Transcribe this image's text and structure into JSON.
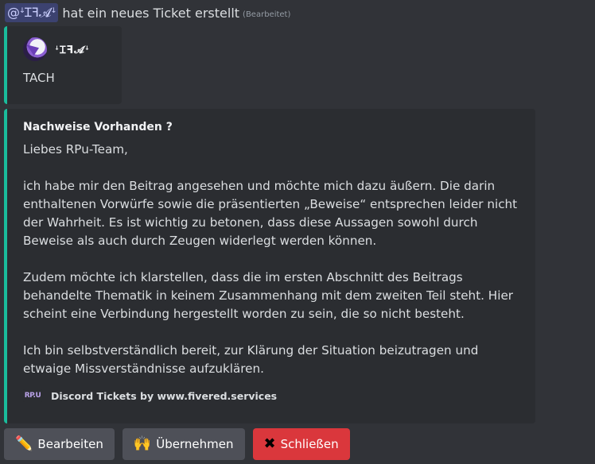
{
  "header": {
    "mention": "@ꜜꞮꟻ𝓐ꜜ",
    "text": "hat ein neues Ticket erstellt",
    "edited": "(Bearbeitet)"
  },
  "embed_author": {
    "name": "ꜜꞮꟻ𝓐ꜜ",
    "content": "TACH"
  },
  "embed_main": {
    "title": "Nachweise Vorhanden ?",
    "greeting": "Liebes RPu-Team,",
    "paragraph1": "ich habe mir den Beitrag angesehen und möchte mich dazu äußern. Die darin enthaltenen Vorwürfe sowie die präsentierten „Beweise“ entsprechen leider nicht der Wahrheit. Es ist wichtig zu betonen, dass diese Aussagen sowohl durch Beweise als auch durch Zeugen widerlegt werden können.",
    "paragraph2": "Zudem möchte ich klarstellen, dass die im ersten Abschnitt des Beitrags behandelte Thematik in keinem Zusammenhang mit dem zweiten Teil steht. Hier scheint eine Verbindung hergestellt worden zu sein, die so nicht besteht.",
    "paragraph3": "Ich bin selbstverständlich bereit, zur Klärung der Situation beizutragen und etwaige Missverständnisse aufzuklären.",
    "footer_logo": "RP.U",
    "footer_text": "Discord Tickets by www.fivered.services"
  },
  "buttons": {
    "edit": {
      "emoji": "✏️",
      "label": "Bearbeiten"
    },
    "claim": {
      "emoji": "🙌",
      "label": "Übernehmen"
    },
    "close": {
      "emoji": "✖",
      "label": "Schließen"
    }
  },
  "colors": {
    "embed_accent": "#1abc9c",
    "danger": "#da373c",
    "mention_bg": "#3c4270"
  }
}
